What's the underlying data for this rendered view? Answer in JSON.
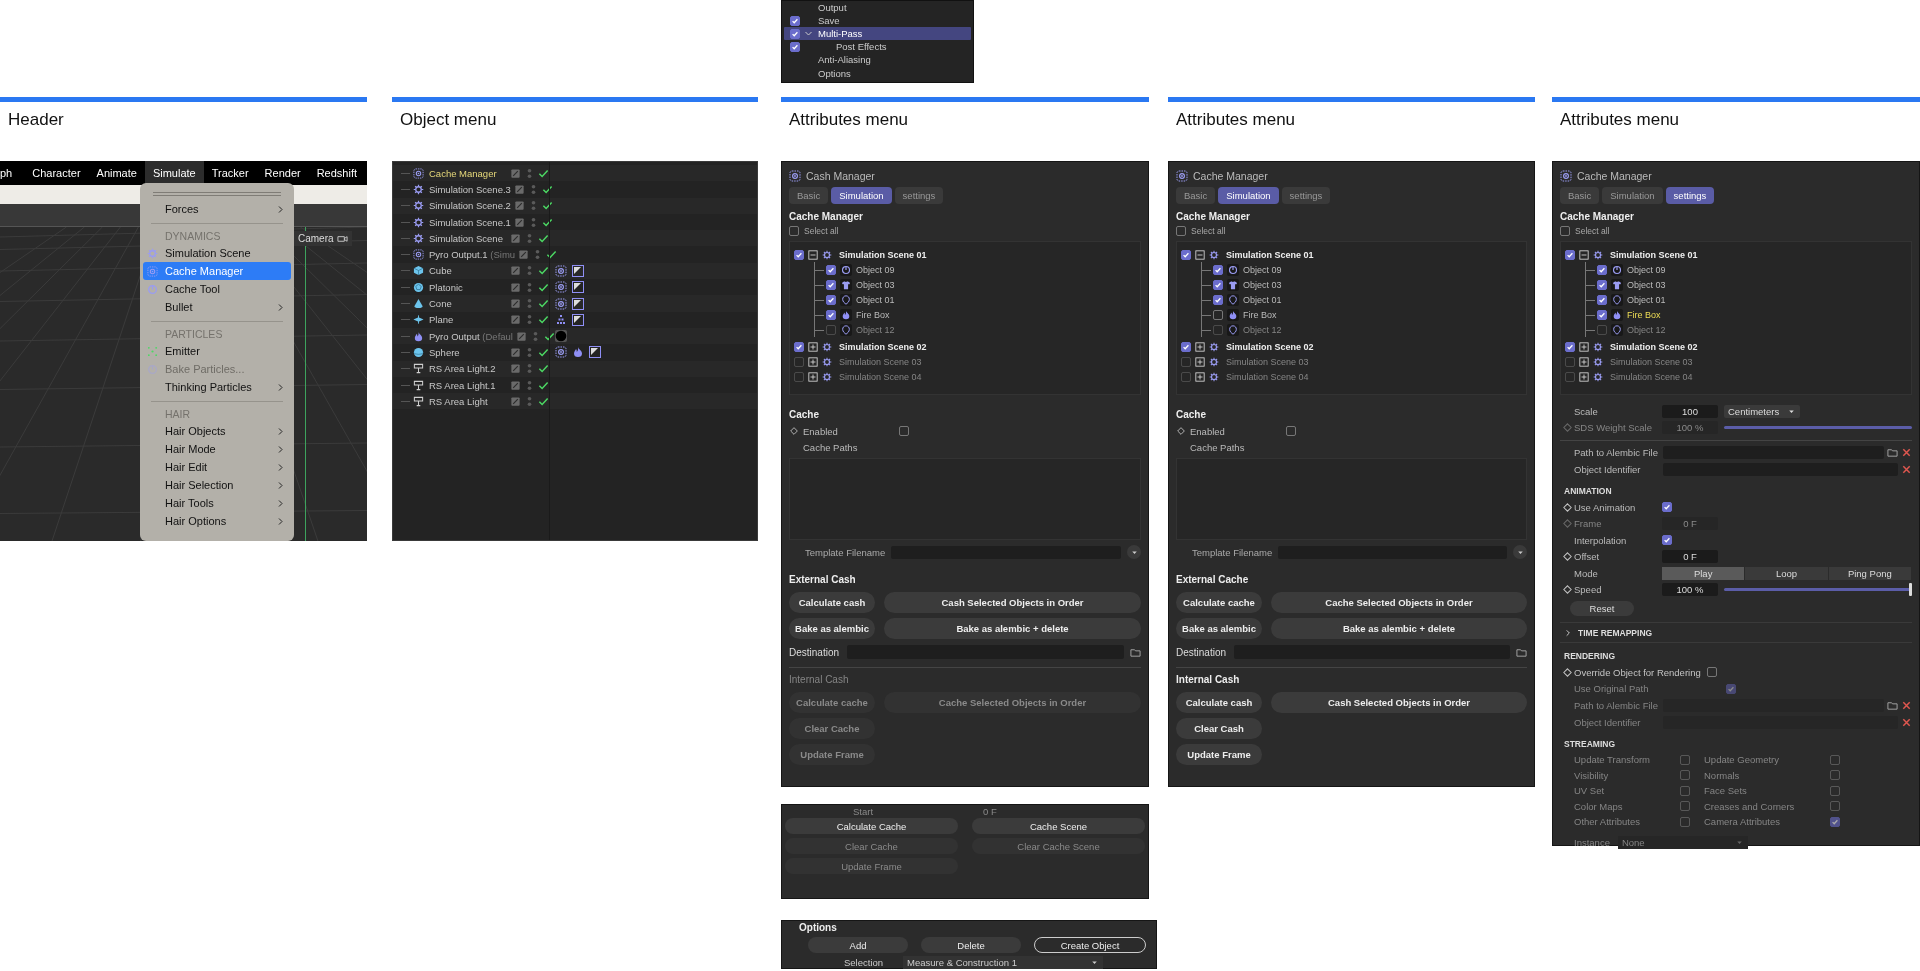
{
  "columns": [
    {
      "kind": "header",
      "title": "Header",
      "menu_bar": [
        {
          "label": "ph",
          "selected": false
        },
        {
          "label": "Character",
          "selected": false
        },
        {
          "label": "Animate",
          "selected": false
        },
        {
          "label": "Simulate",
          "selected": true
        },
        {
          "label": "Tracker",
          "selected": false
        },
        {
          "label": "Render",
          "selected": false
        },
        {
          "label": "Redshift",
          "selected": false
        }
      ],
      "menu": [
        {
          "kind": "grip"
        },
        {
          "kind": "item",
          "label": "Forces",
          "submenu": true,
          "selected": false,
          "disabled": false
        },
        {
          "kind": "separator"
        },
        {
          "kind": "section",
          "label": "DYNAMICS"
        },
        {
          "kind": "item",
          "label": "Simulation Scene",
          "submenu": false,
          "selected": false,
          "disabled": false
        },
        {
          "kind": "item",
          "label": "Cache Manager",
          "submenu": false,
          "selected": true,
          "disabled": false
        },
        {
          "kind": "item",
          "label": "Cache Tool",
          "submenu": false,
          "selected": false,
          "disabled": false
        },
        {
          "kind": "item",
          "label": "Bullet",
          "submenu": true,
          "selected": false,
          "disabled": false
        },
        {
          "kind": "separator"
        },
        {
          "kind": "section",
          "label": "PARTICLES"
        },
        {
          "kind": "item",
          "label": "Emitter",
          "submenu": false,
          "selected": false,
          "disabled": false
        },
        {
          "kind": "item",
          "label": "Bake Particles...",
          "submenu": false,
          "selected": false,
          "disabled": true
        },
        {
          "kind": "item",
          "label": "Thinking Particles",
          "submenu": true,
          "selected": false,
          "disabled": false
        },
        {
          "kind": "separator"
        },
        {
          "kind": "section",
          "label": "HAIR"
        },
        {
          "kind": "item",
          "label": "Hair Objects",
          "submenu": true,
          "selected": false,
          "disabled": false
        },
        {
          "kind": "item",
          "label": "Hair Mode",
          "submenu": true,
          "selected": false,
          "disabled": false
        },
        {
          "kind": "item",
          "label": "Hair Edit",
          "submenu": true,
          "selected": false,
          "disabled": false
        },
        {
          "kind": "item",
          "label": "Hair Selection",
          "submenu": true,
          "selected": false,
          "disabled": false
        },
        {
          "kind": "item",
          "label": "Hair Tools",
          "submenu": true,
          "selected": false,
          "disabled": false
        },
        {
          "kind": "item",
          "label": "Hair Options",
          "submenu": true,
          "selected": false,
          "disabled": false
        }
      ],
      "camera_label": "Camera"
    },
    {
      "kind": "objects",
      "title": "Object menu",
      "objects": [
        {
          "name": "Cache Manager",
          "active": true,
          "enabled": true
        },
        {
          "name": "Simulation Scene.3",
          "active": false,
          "enabled": true
        },
        {
          "name": "Simulation Scene.2",
          "active": false,
          "enabled": true
        },
        {
          "name": "Simulation Scene.1",
          "active": false,
          "enabled": true
        },
        {
          "name": "Simulation Scene",
          "active": false,
          "enabled": true
        },
        {
          "name": "Pyro Output.1",
          "note": "(Simu",
          "active": false,
          "enabled": true
        },
        {
          "name": "Cube",
          "active": false,
          "enabled": true
        },
        {
          "name": "Platonic",
          "active": false,
          "enabled": true
        },
        {
          "name": "Cone",
          "active": false,
          "enabled": true
        },
        {
          "name": "Plane",
          "active": false,
          "enabled": true
        },
        {
          "name": "Pyro Output",
          "note": "(Defaul",
          "active": false,
          "enabled": true
        },
        {
          "name": "Sphere",
          "active": false,
          "enabled": true
        },
        {
          "name": "RS Area Light.2",
          "active": false,
          "enabled": true
        },
        {
          "name": "RS Area Light.1",
          "active": false,
          "enabled": true
        },
        {
          "name": "RS Area Light",
          "active": false,
          "enabled": true
        }
      ]
    },
    {
      "kind": "attributes",
      "title": "Attributes menu",
      "above": {
        "items": [
          {
            "kind": "plain",
            "label": "Output",
            "selected": false
          },
          {
            "kind": "check",
            "label": "Save",
            "checked": true,
            "selected": false
          },
          {
            "kind": "check",
            "label": "Multi-Pass",
            "checked": true,
            "selected": true,
            "expanded": true,
            "children": [
              {
                "kind": "check",
                "label": "Post Effects",
                "checked": true,
                "selected": false
              }
            ]
          },
          {
            "kind": "plain",
            "label": "Anti-Aliasing",
            "selected": false
          },
          {
            "kind": "plain",
            "label": "Options",
            "selected": false
          }
        ]
      },
      "panel": {
        "kind": "simulation",
        "title": "Cash Manager",
        "tabs": [
          {
            "label": "Basic",
            "selected": false
          },
          {
            "label": "Simulation",
            "selected": true
          },
          {
            "label": "settings",
            "selected": false
          }
        ],
        "heading": "Cache Manager",
        "select_all": {
          "label": "Select all",
          "checked": false
        },
        "scenes": [
          {
            "label": "Simulation Scene 01",
            "checked": true,
            "expanded": true,
            "disabled": false,
            "children": [
              {
                "label": "Object 09",
                "checked": true,
                "disabled": false,
                "highlighted": false
              },
              {
                "label": "Object 03",
                "checked": true,
                "disabled": false,
                "highlighted": false
              },
              {
                "label": "Object 01",
                "checked": true,
                "disabled": false,
                "highlighted": false
              },
              {
                "label": "Fire Box",
                "checked": true,
                "disabled": false,
                "highlighted": false
              },
              {
                "label": "Object 12",
                "checked": false,
                "disabled": true,
                "highlighted": false
              }
            ]
          },
          {
            "label": "Simulation Scene 02",
            "checked": true,
            "expanded": false,
            "disabled": false
          },
          {
            "label": "Simulation Scene 03",
            "checked": false,
            "expanded": false,
            "disabled": true
          },
          {
            "label": "Simulation Scene 04",
            "checked": false,
            "expanded": false,
            "disabled": true
          }
        ],
        "cache": {
          "heading": "Cache",
          "enabled_label": "Enabled",
          "enabled": false,
          "paths_label": "Cache Paths",
          "template_label": "Template Filename"
        },
        "external": {
          "heading": "External Cash",
          "disabled": false,
          "buttons": [
            {
              "label": "Calculate cash",
              "wide": false
            },
            {
              "label": "Cash Selected Objects in Order",
              "wide": true
            },
            {
              "label": "Bake as alembic",
              "wide": false
            },
            {
              "label": "Bake as alembic + delete",
              "wide": true
            }
          ]
        },
        "destination_label": "Destination",
        "internal": {
          "heading": "Internal Cash",
          "disabled": true,
          "buttons": [
            {
              "label": "Calculate cache",
              "wide": false
            },
            {
              "label": "Cache Selected Objects in Order",
              "wide": true
            },
            {
              "label": "Clear Cache",
              "wide": false
            },
            {
              "label": "Update Frame",
              "wide": false
            }
          ]
        }
      },
      "below": [
        {
          "kind": "cache_buttons",
          "start_label": "Start",
          "start_value": "0 F",
          "buttons": [
            {
              "label": "Calculate Cache",
              "disabled": false
            },
            {
              "label": "Cache Scene",
              "disabled": false
            },
            {
              "label": "Clear Cache",
              "disabled": true
            },
            {
              "label": "Clear Cache Scene",
              "disabled": true
            },
            {
              "label": "Update Frame",
              "disabled": true
            }
          ]
        },
        {
          "kind": "options",
          "heading": "Options",
          "buttons": [
            {
              "label": "Add",
              "outlined": false
            },
            {
              "label": "Delete",
              "outlined": false
            },
            {
              "label": "Create Object",
              "outlined": true
            }
          ],
          "selection_label": "Selection",
          "selection_value": "Measure & Construction 1"
        }
      ]
    },
    {
      "kind": "attributes",
      "title": "Attributes menu",
      "panel": {
        "kind": "simulation",
        "title": "Cache Manager",
        "tabs": [
          {
            "label": "Basic",
            "selected": false
          },
          {
            "label": "Simulation",
            "selected": true
          },
          {
            "label": "settings",
            "selected": false
          }
        ],
        "heading": "Cache Manager",
        "select_all": {
          "label": "Select all",
          "checked": false
        },
        "scenes": [
          {
            "label": "Simulation Scene 01",
            "checked": true,
            "expanded": true,
            "disabled": false,
            "children": [
              {
                "label": "Object 09",
                "checked": true,
                "disabled": false,
                "highlighted": false
              },
              {
                "label": "Object 03",
                "checked": true,
                "disabled": false,
                "highlighted": false
              },
              {
                "label": "Object 01",
                "checked": true,
                "disabled": false,
                "highlighted": false
              },
              {
                "label": "Fire Box",
                "checked": false,
                "disabled": false,
                "highlighted": false
              },
              {
                "label": "Object 12",
                "checked": false,
                "disabled": true,
                "highlighted": false
              }
            ]
          },
          {
            "label": "Simulation Scene 02",
            "checked": true,
            "expanded": false,
            "disabled": false
          },
          {
            "label": "Simulation Scene 03",
            "checked": false,
            "expanded": false,
            "disabled": true
          },
          {
            "label": "Simulation Scene 04",
            "checked": false,
            "expanded": false,
            "disabled": true
          }
        ],
        "cache": {
          "heading": "Cache",
          "enabled_label": "Enabled",
          "enabled": false,
          "paths_label": "Cache Paths",
          "template_label": "Template Filename"
        },
        "external": {
          "heading": "External Cache",
          "disabled": false,
          "buttons": [
            {
              "label": "Calculate cache",
              "wide": false
            },
            {
              "label": "Cache Selected Objects in Order",
              "wide": true
            },
            {
              "label": "Bake as alembic",
              "wide": false
            },
            {
              "label": "Bake as alembic + delete",
              "wide": true
            }
          ]
        },
        "destination_label": "Destination",
        "internal": {
          "heading": "Internal Cash",
          "disabled": false,
          "buttons": [
            {
              "label": "Calculate cash",
              "wide": false
            },
            {
              "label": "Cash Selected Objects in Order",
              "wide": true
            },
            {
              "label": "Clear Cash",
              "wide": false
            },
            {
              "label": "Update Frame",
              "wide": false
            }
          ]
        }
      }
    },
    {
      "kind": "attributes",
      "title": "Attributes menu",
      "panel": {
        "kind": "settings",
        "title": "Cache Manager",
        "tabs": [
          {
            "label": "Basic",
            "selected": false
          },
          {
            "label": "Simulation",
            "selected": false
          },
          {
            "label": "settings",
            "selected": true
          }
        ],
        "heading": "Cache Manager",
        "select_all": {
          "label": "Select all",
          "checked": false
        },
        "scenes": [
          {
            "label": "Simulation Scene 01",
            "checked": true,
            "expanded": true,
            "disabled": false,
            "children": [
              {
                "label": "Object 09",
                "checked": true,
                "disabled": false,
                "highlighted": false
              },
              {
                "label": "Object 03",
                "checked": true,
                "disabled": false,
                "highlighted": false
              },
              {
                "label": "Object 01",
                "checked": true,
                "disabled": false,
                "highlighted": false
              },
              {
                "label": "Fire Box",
                "checked": true,
                "disabled": false,
                "highlighted": true
              },
              {
                "label": "Object 12",
                "checked": false,
                "disabled": true,
                "highlighted": false
              }
            ]
          },
          {
            "label": "Simulation Scene 02",
            "checked": true,
            "expanded": false,
            "disabled": false
          },
          {
            "label": "Simulation Scene 03",
            "checked": false,
            "expanded": false,
            "disabled": true
          },
          {
            "label": "Simulation Scene 04",
            "checked": false,
            "expanded": false,
            "disabled": true
          }
        ],
        "scale": {
          "label": "Scale",
          "value": "100",
          "unit": "Centimeters"
        },
        "sds": {
          "label": "SDS Weight Scale",
          "value": "100 %",
          "disabled": true,
          "level": 1
        },
        "paths": [
          {
            "label": "Path to Alembic File",
            "browse": true,
            "disabled": false
          },
          {
            "label": "Object Identifier",
            "browse": false,
            "disabled": false
          }
        ],
        "animation": {
          "heading": "ANIMATION",
          "rows": [
            {
              "kind": "check",
              "label": "Use Animation",
              "keyed": true,
              "checked": true,
              "disabled": false
            },
            {
              "kind": "value",
              "label": "Frame",
              "keyed": true,
              "value": "0 F",
              "disabled": true
            },
            {
              "kind": "check",
              "label": "Interpolation",
              "keyed": false,
              "checked": true,
              "disabled": false
            },
            {
              "kind": "value",
              "label": "Offset",
              "keyed": true,
              "value": "0 F",
              "disabled": false
            },
            {
              "kind": "segmented",
              "label": "Mode",
              "keyed": false,
              "disabled": false,
              "options": [
                {
                  "label": "Play",
                  "selected": true
                },
                {
                  "label": "Loop",
                  "selected": false
                },
                {
                  "label": "Ping Pong",
                  "selected": false
                }
              ]
            },
            {
              "kind": "slider",
              "label": "Speed",
              "keyed": true,
              "value": "100 %",
              "level": 1,
              "disabled": false
            }
          ],
          "reset": "Reset"
        },
        "time_remapping": {
          "label": "TIME REMAPPING",
          "expanded": false
        },
        "rendering": {
          "heading": "RENDERING",
          "override": {
            "label": "Override Object for Rendering",
            "checked": false
          },
          "use_original": {
            "label": "Use Original Path",
            "checked": true,
            "disabled": true
          },
          "paths": [
            {
              "label": "Path to Alembic File",
              "browse": true,
              "disabled": true
            },
            {
              "label": "Object Identifier",
              "browse": false,
              "disabled": true
            }
          ]
        },
        "streaming": {
          "heading": "STREAMING",
          "items": [
            {
              "label": "Update Transform",
              "checked": false
            },
            {
              "label": "Update Geometry",
              "checked": false
            },
            {
              "label": "Visibility",
              "checked": false
            },
            {
              "label": "Normals",
              "checked": false
            },
            {
              "label": "UV Set",
              "checked": false
            },
            {
              "label": "Face Sets",
              "checked": false
            },
            {
              "label": "Color Maps",
              "checked": false
            },
            {
              "label": "Creases and Corners",
              "checked": false
            },
            {
              "label": "Other Attributes",
              "checked": false
            },
            {
              "label": "Camera Attributes",
              "checked": true
            }
          ]
        },
        "instance": {
          "label": "Instance",
          "value": "None"
        }
      }
    }
  ]
}
